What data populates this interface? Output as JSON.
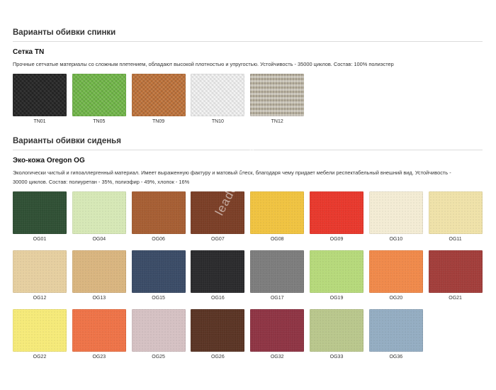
{
  "back_section": {
    "title": "Варианты обивки спинки",
    "material": {
      "title": "Сетка TN",
      "description": "Прочные сетчатые материалы со сложным плетением, обладают высокой плотностью и упругостью. Устойчивость - 35000 циклов. Состав: 100% полиэстер"
    },
    "swatches": [
      {
        "code": "TN01",
        "color": "#2b2b2b"
      },
      {
        "code": "TN05",
        "color": "#6fb646"
      },
      {
        "code": "TN09",
        "color": "#c0733a"
      },
      {
        "code": "TN10",
        "color": "#e9e9e9"
      },
      {
        "code": "TN12",
        "color": "#b9b2a0"
      }
    ]
  },
  "seat_section": {
    "title": "Варианты обивки сиденья",
    "material": {
      "title": "Эко-кожа Oregon OG",
      "description_line1": "Экологически чистый и гипоаллергенный материал. Имеет выраженную фактуру и матовый блеск, благодаря чему придает мебели респектабельный внешний вид. Устойчивость -",
      "description_line2": "30000 циклов. Состав: полиуретан - 35%, полиэфир - 49%, хлопок - 16%"
    },
    "swatches": [
      {
        "code": "OG01",
        "color": "#2f4f34"
      },
      {
        "code": "OG04",
        "color": "#d6e8b6"
      },
      {
        "code": "OG06",
        "color": "#a65e33"
      },
      {
        "code": "OG07",
        "color": "#7a3e26"
      },
      {
        "code": "OG08",
        "color": "#f0c340"
      },
      {
        "code": "OG09",
        "color": "#e8382c"
      },
      {
        "code": "OG10",
        "color": "#f3ecd4"
      },
      {
        "code": "OG11",
        "color": "#efe2a9"
      },
      {
        "code": "OG12",
        "color": "#e6cfa0"
      },
      {
        "code": "OG13",
        "color": "#d9b57f"
      },
      {
        "code": "OG15",
        "color": "#3a4b66"
      },
      {
        "code": "OG16",
        "color": "#2a2a2c"
      },
      {
        "code": "OG17",
        "color": "#7c7c7c"
      },
      {
        "code": "OG19",
        "color": "#b6d97a"
      },
      {
        "code": "OG20",
        "color": "#f0894a"
      },
      {
        "code": "OG21",
        "color": "#a23d3a"
      },
      {
        "code": "OG22",
        "color": "#f5ea78"
      },
      {
        "code": "OG23",
        "color": "#ee7347"
      },
      {
        "code": "OG25",
        "color": "#d5c1c3"
      },
      {
        "code": "OG26",
        "color": "#5a3424"
      },
      {
        "code": "OG32",
        "color": "#8e3443"
      },
      {
        "code": "OG33",
        "color": "#b9c78c"
      },
      {
        "code": "OG36",
        "color": "#94adc2"
      }
    ]
  },
  "watermark": "leader-mebel.ru"
}
